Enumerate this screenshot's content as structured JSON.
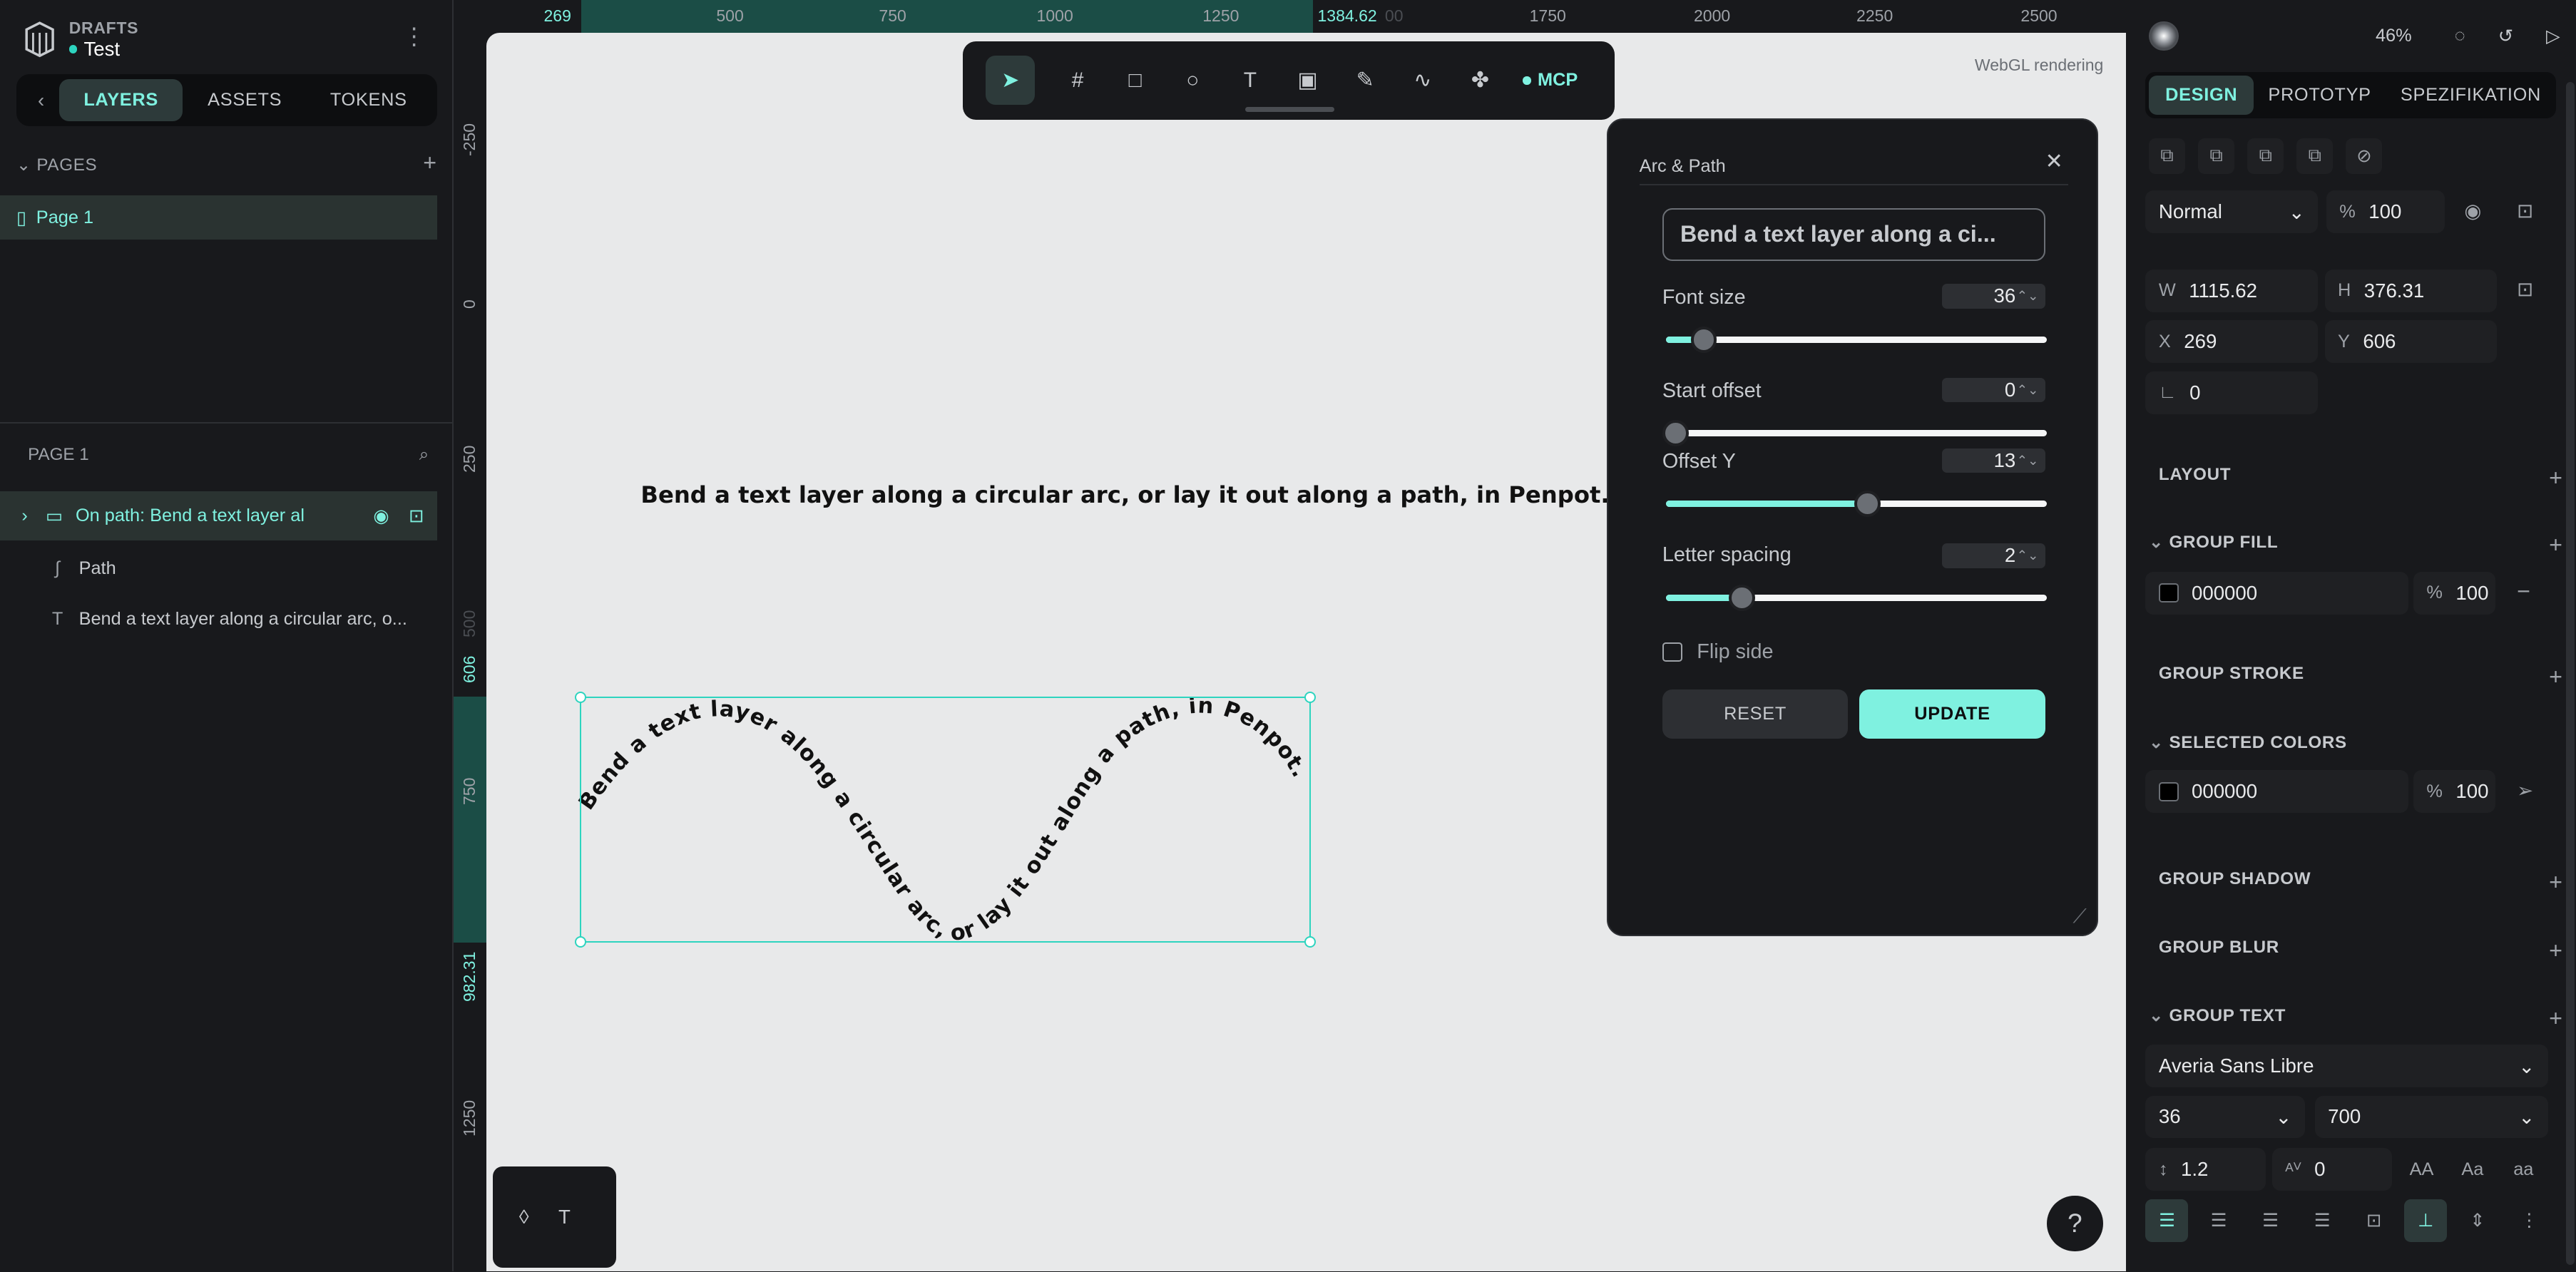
{
  "brand": {
    "section": "DRAFTS",
    "project": "Test"
  },
  "left_tabs": [
    "LAYERS",
    "ASSETS",
    "TOKENS"
  ],
  "pages": {
    "header": "PAGES",
    "items": [
      "Page 1"
    ]
  },
  "layers": {
    "header": "PAGE 1",
    "items": [
      {
        "name": "On path: Bend a text layer al",
        "icon": "folder-icon",
        "selected": true
      },
      {
        "name": "Path",
        "icon": "path-icon",
        "selected": false
      },
      {
        "name": "Bend a text layer along a circular arc, o...",
        "icon": "text-icon",
        "selected": false
      }
    ]
  },
  "ruler_top": {
    "selected_start": "269",
    "selected_end": "1384.62",
    "ticks": [
      "500",
      "750",
      "1000",
      "1250",
      "1750",
      "2000",
      "2250",
      "2500"
    ],
    "faded": "00"
  },
  "ruler_left": {
    "ticks": [
      "-250",
      "0",
      "250",
      "750",
      "1250"
    ],
    "selected_start": "606",
    "selected_end": "982.31",
    "faded": "500"
  },
  "canvas": {
    "webgl": "WebGL rendering",
    "heading": "Bend a text layer along a circular arc, or lay it out along a path, in Penpot.",
    "curve_text": "Bend a text layer along a circular arc, or lay it out along a path, in Penpot."
  },
  "toolbar": {
    "tools": [
      "pointer-icon",
      "board-icon",
      "rectangle-icon",
      "ellipse-icon",
      "text-icon",
      "image-icon",
      "pencil-icon",
      "path-icon",
      "plugins-icon"
    ],
    "mcp": "MCP"
  },
  "plugin": {
    "title": "Arc & Path",
    "input_value": "Bend a text layer along a ci...",
    "font_size": {
      "label": "Font size",
      "value": "36",
      "fraction": 0.1
    },
    "start_offset": {
      "label": "Start offset",
      "value": "0",
      "fraction": 0.0
    },
    "offset_y": {
      "label": "Offset Y",
      "value": "13",
      "fraction": 0.53
    },
    "letter_spacing": {
      "label": "Letter spacing",
      "value": "2",
      "fraction": 0.2
    },
    "flip": "Flip side",
    "reset": "RESET",
    "update": "UPDATE"
  },
  "right": {
    "zoom": "46%",
    "tabs": [
      "DESIGN",
      "PROTOTYP",
      "SPEZIFIKATION"
    ],
    "blend": "Normal",
    "opacity_unit": "%",
    "opacity": "100",
    "w_label": "W",
    "w": "1115.62",
    "h_label": "H",
    "h": "376.31",
    "x_label": "X",
    "x": "269",
    "y_label": "Y",
    "y": "606",
    "rotation": "0",
    "sections": {
      "layout": "LAYOUT",
      "group_fill": "GROUP FILL",
      "group_stroke": "GROUP STROKE",
      "selected_colors": "SELECTED COLORS",
      "group_shadow": "GROUP SHADOW",
      "group_blur": "GROUP BLUR",
      "group_text": "GROUP TEXT"
    },
    "fill": {
      "hex": "000000",
      "unit": "%",
      "opacity": "100"
    },
    "selected_color": {
      "hex": "000000",
      "unit": "%",
      "opacity": "100"
    },
    "font_family": "Averia Sans Libre",
    "font_size": "36",
    "font_weight": "700",
    "line_height": "1.2",
    "letter_spacing": "0",
    "case_buttons": [
      "AA",
      "Aa",
      "aa"
    ]
  },
  "colors": {
    "accent": "#7ff1e0",
    "teal": "#2dd4bf",
    "panel": "#18191c",
    "canvas": "#e8e9ea"
  }
}
